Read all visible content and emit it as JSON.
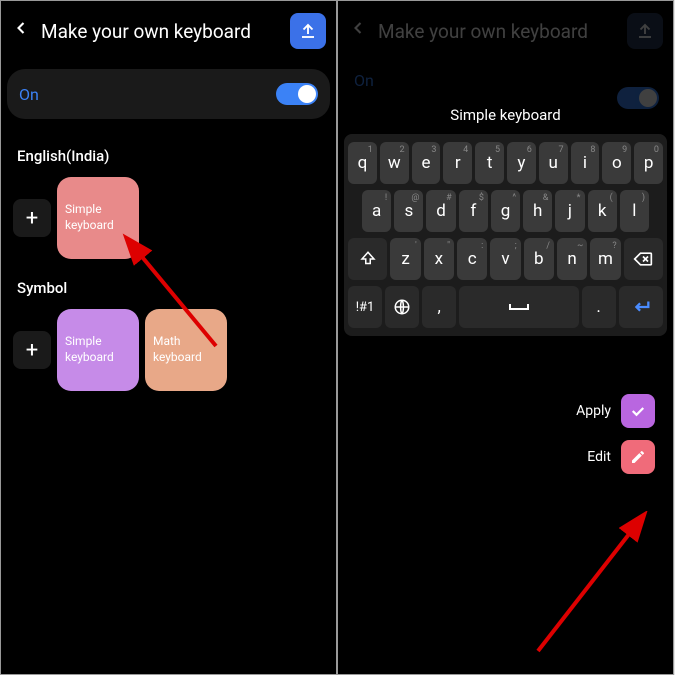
{
  "panel1": {
    "title": "Make your own keyboard",
    "toggle_label": "On",
    "section1": "English(India)",
    "section2": "Symbol",
    "tile1": "Simple keyboard",
    "tile2": "Simple keyboard",
    "tile3": "Math keyboard"
  },
  "panel2": {
    "title": "Make your own keyboard",
    "toggle_label": "On",
    "kbd_title": "Simple keyboard",
    "row1": [
      {
        "main": "q",
        "alt": "1"
      },
      {
        "main": "w",
        "alt": "2"
      },
      {
        "main": "e",
        "alt": "3"
      },
      {
        "main": "r",
        "alt": "4"
      },
      {
        "main": "t",
        "alt": "5"
      },
      {
        "main": "y",
        "alt": "6"
      },
      {
        "main": "u",
        "alt": "7"
      },
      {
        "main": "i",
        "alt": "8"
      },
      {
        "main": "o",
        "alt": "9"
      },
      {
        "main": "p",
        "alt": "0"
      }
    ],
    "row2": [
      {
        "main": "a",
        "alt": "!"
      },
      {
        "main": "s",
        "alt": "@"
      },
      {
        "main": "d",
        "alt": "#"
      },
      {
        "main": "f",
        "alt": "$"
      },
      {
        "main": "g",
        "alt": "^"
      },
      {
        "main": "h",
        "alt": "&"
      },
      {
        "main": "j",
        "alt": "*"
      },
      {
        "main": "k",
        "alt": "("
      },
      {
        "main": "l",
        "alt": ")"
      }
    ],
    "row3": [
      {
        "main": "z",
        "alt": "'"
      },
      {
        "main": "x",
        "alt": "\""
      },
      {
        "main": "c",
        "alt": ":"
      },
      {
        "main": "v",
        "alt": ";"
      },
      {
        "main": "b",
        "alt": "/"
      },
      {
        "main": "n",
        "alt": "~"
      },
      {
        "main": "m",
        "alt": "?"
      }
    ],
    "sym_key": "!#1",
    "comma": ",",
    "dot": ".",
    "apply": "Apply",
    "edit": "Edit"
  }
}
